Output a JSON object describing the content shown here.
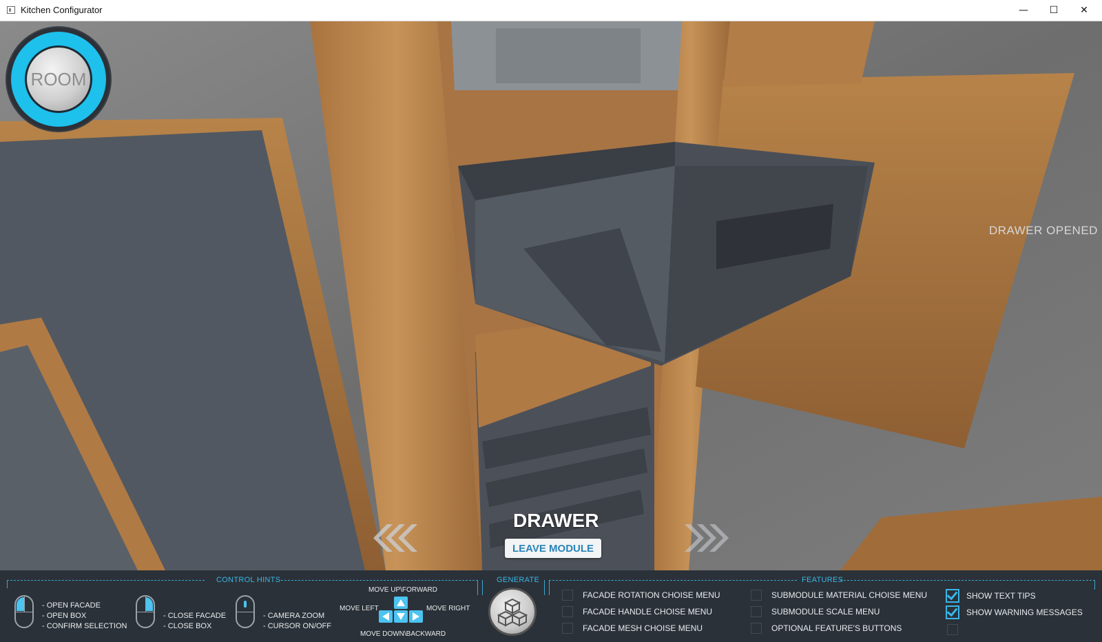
{
  "window": {
    "title": "Kitchen Configurator",
    "minimize": "—",
    "maximize": "☐",
    "close": "✕"
  },
  "room_button": {
    "label": "ROOM"
  },
  "status_message": "DRAWER OPENED",
  "module": {
    "name": "DRAWER",
    "leave_label": "LEAVE MODULE"
  },
  "control_hints": {
    "title": "CONTROL HINTS",
    "left_click": [
      "- OPEN FACADE",
      "- OPEN BOX",
      "- CONFIRM SELECTION"
    ],
    "right_click": [
      "- CLOSE FACADE",
      "- CLOSE BOX"
    ],
    "wheel": [
      "- CAMERA ZOOM",
      "- CURSOR ON/OFF"
    ],
    "move_up": "MOVE UP\\FORWARD",
    "move_left": "MOVE LEFT",
    "move_right": "MOVE RIGHT",
    "move_down": "MOVE DOWN\\BACKWARD"
  },
  "generate": {
    "title": "GENERATE"
  },
  "features": {
    "title": "FEATURES",
    "items": [
      {
        "label": "FACADE ROTATION CHOISE MENU",
        "checked": false
      },
      {
        "label": "FACADE HANDLE CHOISE MENU",
        "checked": false
      },
      {
        "label": "FACADE MESH CHOISE MENU",
        "checked": false
      },
      {
        "label": "SUBMODULE MATERIAL CHOISE MENU",
        "checked": false
      },
      {
        "label": "SUBMODULE SCALE MENU",
        "checked": false
      },
      {
        "label": "OPTIONAL FEATURE'S BUTTONS",
        "checked": false
      },
      {
        "label": "SHOW TEXT TIPS",
        "checked": true
      },
      {
        "label": "SHOW WARNING MESSAGES",
        "checked": true
      }
    ]
  },
  "colors": {
    "accent": "#39b6e8",
    "panel": "#2b3138",
    "wood": "#b8834f",
    "drawer": "#4c5058"
  }
}
